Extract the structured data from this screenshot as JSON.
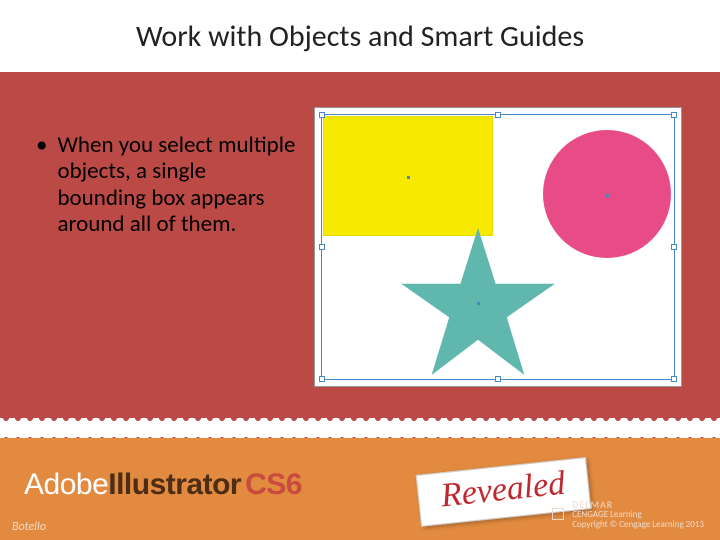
{
  "title": "Work with Objects and Smart Guides",
  "bullet": {
    "marker": "•",
    "text": "When you select multiple objects, a single bounding box appears around all of them."
  },
  "figure": {
    "shapes": {
      "square_color": "#f7ea00",
      "circle_color": "#e84c87",
      "star_color": "#5fb7ad"
    }
  },
  "footer": {
    "brand_part1": "Adobe",
    "brand_part2": "Illustrator",
    "brand_part3": "CS6",
    "revealed": "Revealed",
    "author": "Botello",
    "publisher_line1": "DELMAR",
    "publisher_line2": "CENGAGE Learning",
    "copyright": "Copyright © Cengage Learning 2013"
  }
}
